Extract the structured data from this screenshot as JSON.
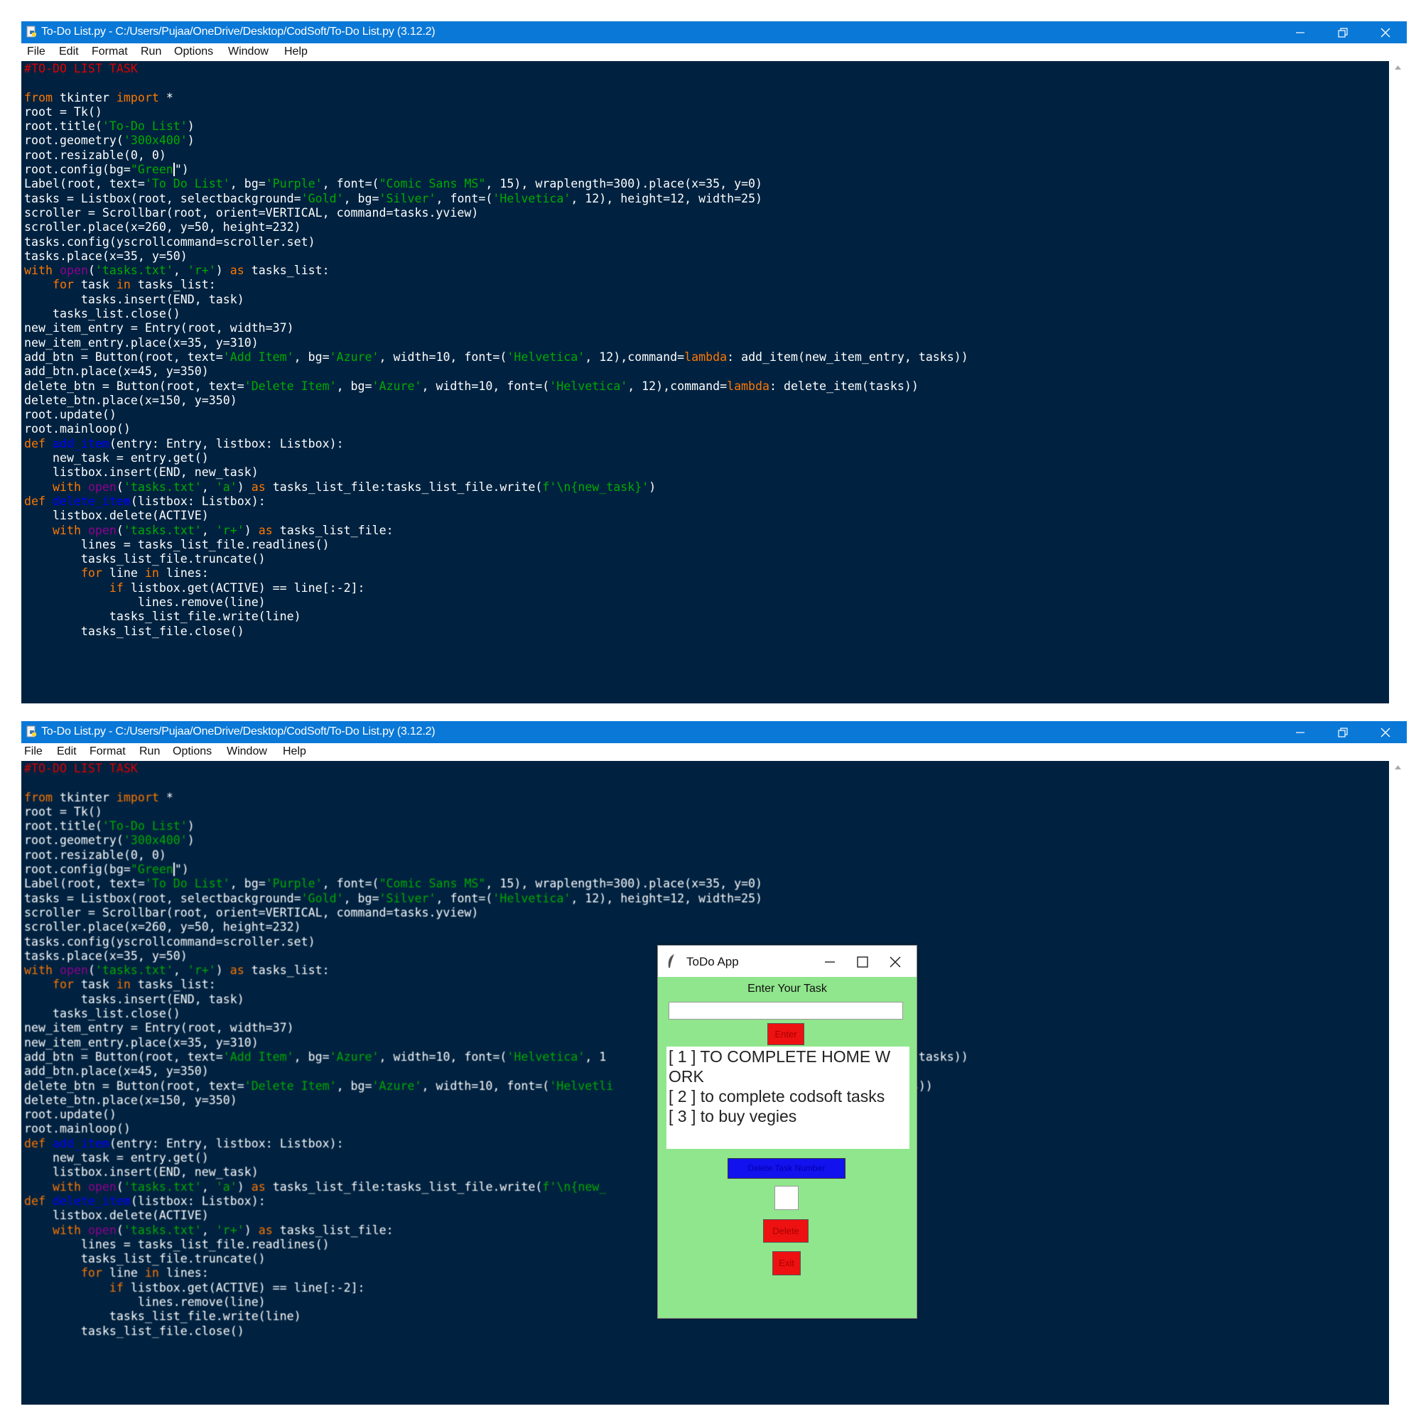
{
  "window_top": {
    "title": "To-Do List.py - C:/Users/Pujaa/OneDrive/Desktop/CodSoft/To-Do List.py (3.12.2)",
    "menu": [
      "File",
      "Edit",
      "Format",
      "Run",
      "Options",
      "Window",
      "Help"
    ]
  },
  "window_bottom": {
    "title": "To-Do List.py - C:/Users/Pujaa/OneDrive/Desktop/CodSoft/To-Do List.py (3.12.2)",
    "menu": [
      "File",
      "Edit",
      "Format",
      "Run",
      "Options",
      "Window",
      "Help"
    ]
  },
  "code_top": [
    [
      [
        "#TO-DO LIST TASK",
        "cm"
      ]
    ],
    [],
    [
      [
        "from",
        "kw"
      ],
      [
        " tkinter ",
        ""
      ],
      [
        "import",
        "kw"
      ],
      [
        " *",
        ""
      ]
    ],
    [
      [
        "root = Tk()",
        ""
      ]
    ],
    [
      [
        "root.title(",
        ""
      ],
      [
        "'To-Do List'",
        "st"
      ],
      [
        ")",
        ""
      ]
    ],
    [
      [
        "root.geometry(",
        ""
      ],
      [
        "'300x400'",
        "st"
      ],
      [
        ")",
        ""
      ]
    ],
    [
      [
        "root.resizable(0, 0)",
        ""
      ]
    ],
    [
      [
        "root.config(bg=",
        ""
      ],
      [
        "\"Green",
        "st"
      ],
      [
        "",
        "cur"
      ],
      [
        "\")",
        ""
      ]
    ],
    [
      [
        "Label(root, text=",
        ""
      ],
      [
        "'To Do List'",
        "st"
      ],
      [
        ", bg=",
        ""
      ],
      [
        "'Purple'",
        "st"
      ],
      [
        ", font=(",
        ""
      ],
      [
        "\"Comic Sans MS\"",
        "st"
      ],
      [
        ", 15), wraplength=300).place(x=35, y=0)",
        ""
      ]
    ],
    [
      [
        "tasks = Listbox(root, selectbackground=",
        ""
      ],
      [
        "'Gold'",
        "st"
      ],
      [
        ", bg=",
        ""
      ],
      [
        "'Silver'",
        "st"
      ],
      [
        ", font=(",
        ""
      ],
      [
        "'Helvetica'",
        "st"
      ],
      [
        ", 12), height=12, width=25)",
        ""
      ]
    ],
    [
      [
        "scroller = Scrollbar(root, orient=VERTICAL, command=tasks.yview)",
        ""
      ]
    ],
    [
      [
        "scroller.place(x=260, y=50, height=232)",
        ""
      ]
    ],
    [
      [
        "tasks.config(yscrollcommand=scroller.set)",
        ""
      ]
    ],
    [
      [
        "tasks.place(x=35, y=50)",
        ""
      ]
    ],
    [
      [
        "with",
        "kw"
      ],
      [
        " ",
        ""
      ],
      [
        "open",
        "bi"
      ],
      [
        "(",
        ""
      ],
      [
        "'tasks.txt'",
        "st"
      ],
      [
        ", ",
        ""
      ],
      [
        "'r+'",
        "st"
      ],
      [
        ") ",
        ""
      ],
      [
        "as",
        "kw"
      ],
      [
        " tasks_list:",
        ""
      ]
    ],
    [
      [
        "    ",
        ""
      ],
      [
        "for",
        "kw"
      ],
      [
        " task ",
        ""
      ],
      [
        "in",
        "kw"
      ],
      [
        " tasks_list:",
        ""
      ]
    ],
    [
      [
        "        tasks.insert(END, task)",
        ""
      ]
    ],
    [
      [
        "    tasks_list.close()",
        ""
      ]
    ],
    [
      [
        "new_item_entry = Entry(root, width=37)",
        ""
      ]
    ],
    [
      [
        "new_item_entry.place(x=35, y=310)",
        ""
      ]
    ],
    [
      [
        "add_btn = Button(root, text=",
        ""
      ],
      [
        "'Add Item'",
        "st"
      ],
      [
        ", bg=",
        ""
      ],
      [
        "'Azure'",
        "st"
      ],
      [
        ", width=10, font=(",
        ""
      ],
      [
        "'Helvetica'",
        "st"
      ],
      [
        ", 12),command=",
        ""
      ],
      [
        "lambda",
        "kw"
      ],
      [
        ": add_item(new_item_entry, tasks))",
        ""
      ]
    ],
    [
      [
        "add_btn.place(x=45, y=350)",
        ""
      ]
    ],
    [
      [
        "delete_btn = Button(root, text=",
        ""
      ],
      [
        "'Delete Item'",
        "st"
      ],
      [
        ", bg=",
        ""
      ],
      [
        "'Azure'",
        "st"
      ],
      [
        ", width=10, font=(",
        ""
      ],
      [
        "'Helvetica'",
        "st"
      ],
      [
        ", 12),command=",
        ""
      ],
      [
        "lambda",
        "kw"
      ],
      [
        ": delete_item(tasks))",
        ""
      ]
    ],
    [
      [
        "delete_btn.place(x=150, y=350)",
        ""
      ]
    ],
    [
      [
        "root.update()",
        ""
      ]
    ],
    [
      [
        "root.mainloop()",
        ""
      ]
    ],
    [
      [
        "def",
        "kw"
      ],
      [
        " ",
        ""
      ],
      [
        "add_item",
        "df"
      ],
      [
        "(entry: Entry, listbox: Listbox):",
        ""
      ]
    ],
    [
      [
        "    new_task = entry.get()",
        ""
      ]
    ],
    [
      [
        "    listbox.insert(END, new_task)",
        ""
      ]
    ],
    [
      [
        "    ",
        ""
      ],
      [
        "with",
        "kw"
      ],
      [
        " ",
        ""
      ],
      [
        "open",
        "bi"
      ],
      [
        "(",
        ""
      ],
      [
        "'tasks.txt'",
        "st"
      ],
      [
        ", ",
        ""
      ],
      [
        "'a'",
        "st"
      ],
      [
        ") ",
        ""
      ],
      [
        "as",
        "kw"
      ],
      [
        " tasks_list_file:tasks_list_file.write(",
        ""
      ],
      [
        "f'\\n{new_task}'",
        "st"
      ],
      [
        ")",
        ""
      ]
    ],
    [
      [
        "def",
        "kw"
      ],
      [
        " ",
        ""
      ],
      [
        "delete_item",
        "df"
      ],
      [
        "(listbox: Listbox):",
        ""
      ]
    ],
    [
      [
        "    listbox.delete(ACTIVE)",
        ""
      ]
    ],
    [
      [
        "    ",
        ""
      ],
      [
        "with",
        "kw"
      ],
      [
        " ",
        ""
      ],
      [
        "open",
        "bi"
      ],
      [
        "(",
        ""
      ],
      [
        "'tasks.txt'",
        "st"
      ],
      [
        ", ",
        ""
      ],
      [
        "'r+'",
        "st"
      ],
      [
        ") ",
        ""
      ],
      [
        "as",
        "kw"
      ],
      [
        " tasks_list_file:",
        ""
      ]
    ],
    [
      [
        "        lines = tasks_list_file.readlines()",
        ""
      ]
    ],
    [
      [
        "        tasks_list_file.truncate()",
        ""
      ]
    ],
    [
      [
        "        ",
        ""
      ],
      [
        "for",
        "kw"
      ],
      [
        " line ",
        ""
      ],
      [
        "in",
        "kw"
      ],
      [
        " lines:",
        ""
      ]
    ],
    [
      [
        "            ",
        ""
      ],
      [
        "if",
        "kw"
      ],
      [
        " listbox.get(ACTIVE) == line[:-2]:",
        ""
      ]
    ],
    [
      [
        "                lines.remove(line)",
        ""
      ]
    ],
    [
      [
        "            tasks_list_file.write(line)",
        ""
      ]
    ],
    [
      [
        "        tasks_list_file.close()",
        ""
      ]
    ]
  ],
  "code_bottom": [
    [
      [
        "#TO-DO LIST TASK",
        "cm"
      ]
    ],
    [],
    [
      [
        "from",
        "kw"
      ],
      [
        " tkinter ",
        ""
      ],
      [
        "import",
        "kw"
      ],
      [
        " *",
        ""
      ]
    ],
    [
      [
        "root = Tk()",
        ""
      ]
    ],
    [
      [
        "root.title(",
        ""
      ],
      [
        "'To-Do List'",
        "st"
      ],
      [
        ")",
        ""
      ]
    ],
    [
      [
        "root.geometry(",
        ""
      ],
      [
        "'300x400'",
        "st"
      ],
      [
        ")",
        ""
      ]
    ],
    [
      [
        "root.resizable(0, 0)",
        ""
      ]
    ],
    [
      [
        "root.config(bg=",
        ""
      ],
      [
        "\"Green",
        "st"
      ],
      [
        "",
        "cur"
      ],
      [
        "\")",
        ""
      ]
    ],
    [
      [
        "Label(root, text=",
        ""
      ],
      [
        "'To Do List'",
        "st"
      ],
      [
        ", bg=",
        ""
      ],
      [
        "'Purple'",
        "st"
      ],
      [
        ", font=(",
        ""
      ],
      [
        "\"Comic Sans MS\"",
        "st"
      ],
      [
        ", 15), wraplength=300).place(x=35, y=0)",
        ""
      ]
    ],
    [
      [
        "tasks = Listbox(root, selectbackground=",
        ""
      ],
      [
        "'Gold'",
        "st"
      ],
      [
        ", bg=",
        ""
      ],
      [
        "'Silver'",
        "st"
      ],
      [
        ", font=(",
        ""
      ],
      [
        "'Helvetica'",
        "st"
      ],
      [
        ", 12), height=12, width=25)",
        ""
      ]
    ],
    [
      [
        "scroller = Scrollbar(root, orient=VERTICAL, command=tasks.yview)",
        ""
      ]
    ],
    [
      [
        "scroller.place(x=260, y=50, height=232)",
        ""
      ]
    ],
    [
      [
        "tasks.config(yscrollcommand=scroller.set)",
        ""
      ]
    ],
    [
      [
        "tasks.place(x=35, y=50)",
        ""
      ]
    ],
    [
      [
        "with",
        "kw"
      ],
      [
        " ",
        ""
      ],
      [
        "open",
        "bi"
      ],
      [
        "(",
        ""
      ],
      [
        "'tasks.txt'",
        "st"
      ],
      [
        ", ",
        ""
      ],
      [
        "'r+'",
        "st"
      ],
      [
        ") ",
        ""
      ],
      [
        "as",
        "kw"
      ],
      [
        " tasks_list:",
        ""
      ]
    ],
    [
      [
        "    ",
        ""
      ],
      [
        "for",
        "kw"
      ],
      [
        " task ",
        ""
      ],
      [
        "in",
        "kw"
      ],
      [
        " tasks_list:",
        ""
      ]
    ],
    [
      [
        "        tasks.insert(END, task)",
        ""
      ]
    ],
    [
      [
        "    tasks_list.close()",
        ""
      ]
    ],
    [
      [
        "new_item_entry = Entry(root, width=37)",
        ""
      ]
    ],
    [
      [
        "new_item_entry.place(x=35, y=310)",
        ""
      ]
    ],
    [
      [
        "add_btn = Button(root, text=",
        ""
      ],
      [
        "'Add Item'",
        "st"
      ],
      [
        ", bg=",
        ""
      ],
      [
        "'Azure'",
        "st"
      ],
      [
        ", width=10, font=(",
        ""
      ],
      [
        "'Helvetica'",
        "st"
      ],
      [
        ", 1",
        ""
      ],
      [
        "                                  ",
        ""
      ],
      [
        "em_entry, tasks))",
        ""
      ]
    ],
    [
      [
        "add_btn.place(x=45, y=350)",
        ""
      ]
    ],
    [
      [
        "delete_btn = Button(root, text=",
        ""
      ],
      [
        "'Delete Item'",
        "st"
      ],
      [
        ", bg=",
        ""
      ],
      [
        "'Azure'",
        "st"
      ],
      [
        ", width=10, font=(",
        ""
      ],
      [
        "'Helvetli",
        "st"
      ],
      [
        "                                   ",
        ""
      ],
      [
        "em(tasks))",
        ""
      ]
    ],
    [
      [
        "delete_btn.place(x=150, y=350)",
        ""
      ]
    ],
    [
      [
        "root.update()",
        ""
      ]
    ],
    [
      [
        "root.mainloop()",
        ""
      ]
    ],
    [
      [
        "def",
        "kw"
      ],
      [
        " ",
        ""
      ],
      [
        "add_item",
        "df"
      ],
      [
        "(entry: Entry, listbox: Listbox):",
        ""
      ]
    ],
    [
      [
        "    new_task = entry.get()",
        ""
      ]
    ],
    [
      [
        "    listbox.insert(END, new_task)",
        ""
      ]
    ],
    [
      [
        "    ",
        ""
      ],
      [
        "with",
        "kw"
      ],
      [
        " ",
        ""
      ],
      [
        "open",
        "bi"
      ],
      [
        "(",
        ""
      ],
      [
        "'tasks.txt'",
        "st"
      ],
      [
        ", ",
        ""
      ],
      [
        "'a'",
        "st"
      ],
      [
        ") ",
        ""
      ],
      [
        "as",
        "kw"
      ],
      [
        " tasks_list_file:tasks_list_file.write(",
        ""
      ],
      [
        "f'\\n{new_",
        "st"
      ]
    ],
    [
      [
        "def",
        "kw"
      ],
      [
        " ",
        ""
      ],
      [
        "delete_item",
        "df"
      ],
      [
        "(listbox: Listbox):",
        ""
      ]
    ],
    [
      [
        "    listbox.delete(ACTIVE)",
        ""
      ]
    ],
    [
      [
        "    ",
        ""
      ],
      [
        "with",
        "kw"
      ],
      [
        " ",
        ""
      ],
      [
        "open",
        "bi"
      ],
      [
        "(",
        ""
      ],
      [
        "'tasks.txt'",
        "st"
      ],
      [
        ", ",
        ""
      ],
      [
        "'r+'",
        "st"
      ],
      [
        ") ",
        ""
      ],
      [
        "as",
        "kw"
      ],
      [
        " tasks_list_file:",
        ""
      ]
    ],
    [
      [
        "        lines = tasks_list_file.readlines()",
        ""
      ]
    ],
    [
      [
        "        tasks_list_file.truncate()",
        ""
      ]
    ],
    [
      [
        "        ",
        ""
      ],
      [
        "for",
        "kw"
      ],
      [
        " line ",
        ""
      ],
      [
        "in",
        "kw"
      ],
      [
        " lines:",
        ""
      ]
    ],
    [
      [
        "            ",
        ""
      ],
      [
        "if",
        "kw"
      ],
      [
        " listbox.get(ACTIVE) == line[:-2]:",
        ""
      ]
    ],
    [
      [
        "                lines.remove(line)",
        ""
      ]
    ],
    [
      [
        "            tasks_list_file.write(line)",
        ""
      ]
    ],
    [
      [
        "        tasks_list_file.close()",
        ""
      ]
    ]
  ],
  "todo_app": {
    "title": "ToDo App",
    "prompt": "Enter Your Task",
    "entry_value": "",
    "enter_button": "Enter",
    "tasks": [
      "[ 1 ] TO COMPLETE HOME W",
      "ORK",
      "[ 2 ] to complete codsoft tasks",
      "[ 3 ] to buy vegies"
    ],
    "delete_number_label": "Delete Task Number",
    "number_value": "",
    "delete_button": "Delete",
    "exit_button": "Exit"
  },
  "colors": {
    "titlebar": "#0a78d7",
    "editor_bg": "#002240",
    "keyword": "#ff7700",
    "string": "#00aa00",
    "comment": "#dd0000",
    "builtin": "#900090",
    "definition": "#0000ff",
    "app_bg": "#90e68c",
    "red_button": "#ee1111",
    "blue_button": "#1212ee"
  }
}
